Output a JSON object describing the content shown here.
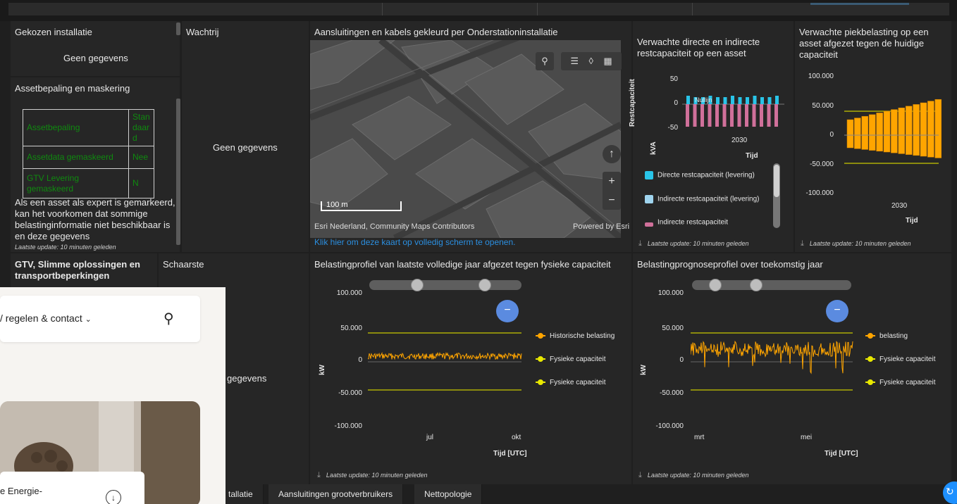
{
  "panels": {
    "gekozen": {
      "title": "Gekozen installatie",
      "nodata": "Geen gegevens"
    },
    "wachtrij": {
      "title": "Wachtrij",
      "nodata": "Geen gegevens"
    },
    "asset": {
      "title": "Assetbepaling en maskering",
      "rows": [
        {
          "label": "Assetbepaling",
          "value": "Standaard"
        },
        {
          "label": "Assetdata gemaskeerd",
          "value": "Nee"
        },
        {
          "label": "GTV Levering gemaskeerd",
          "value": "N"
        }
      ],
      "note": "Als een asset als expert is gemarkeerd, kan het voorkomen dat sommige belastinginformatie niet beschikbaar is en deze gegevens",
      "updated": "Laatste update: 10 minuten geleden"
    },
    "gtv": {
      "title": "GTV, Slimme oplossingen en transportbeperkingen"
    },
    "schaarste": {
      "title": "Schaarste",
      "nodata": "gegevens"
    },
    "map": {
      "title": "Aansluitingen en kabels gekleurd per Onderstationinstallatie",
      "scale": "100 m",
      "attribution": "Esri Nederland, Community Maps Contributors",
      "powered": "Powered by Esri",
      "link": "Klik hier om deze kaart op volledig scherm te openen."
    },
    "restcap": {
      "title": "Verwachte directe en indirecte restcapaciteit op een asset",
      "yticks": [
        "50",
        "0",
        "-50"
      ],
      "xtick": "2030",
      "xtitle": "Tijd",
      "ytitle1": "Restcapaciteit",
      "ytitle2": "kVA",
      "annotation": "Nullijn",
      "legend": [
        "Directe restcapaciteit (levering)",
        "Indirecte restcapaciteit (levering)",
        "Indirecte restcapaciteit"
      ],
      "updated": "Laatste update: 10 minuten geleden"
    },
    "piek": {
      "title": "Verwachte piekbelasting op een asset afgezet tegen de huidige capaciteit",
      "yticks": [
        "100.000",
        "50.000",
        "0",
        "-50.000",
        "-100.000"
      ],
      "xtick": "2030",
      "xtitle": "Tijd",
      "updated": "Laatste update: 10 minuten geleden"
    },
    "profiel": {
      "title": "Belastingprofiel van laatste volledige jaar afgezet tegen fysieke capaciteit",
      "yticks": [
        "100.000",
        "50.000",
        "0",
        "-50.000",
        "-100.000"
      ],
      "xticks": [
        "jul",
        "okt"
      ],
      "xtitle": "Tijd [UTC]",
      "ytitle": "kW",
      "legend": [
        "Historische belasting",
        "Fysieke capaciteit",
        "Fysieke capaciteit"
      ],
      "updated": "Laatste update: 10 minuten geleden"
    },
    "prognose": {
      "title": "Belastingprognoseprofiel over toekomstig jaar",
      "yticks": [
        "100.000",
        "50.000",
        "0",
        "-50.000",
        "-100.000"
      ],
      "xticks": [
        "mrt",
        "mei"
      ],
      "xtitle": "Tijd [UTC]",
      "ytitle": "kW",
      "legend": [
        "belasting",
        "Fysieke capaciteit",
        "Fysieke capaciteit"
      ],
      "updated": "Laatste update: 10 minuten geleden"
    }
  },
  "tabs": [
    "tallatie",
    "Aansluitingen grootverbruikers",
    "Nettopologie"
  ],
  "overlay": {
    "menu": "/ regelen & contact",
    "card_text": "e Energie-"
  },
  "colors": {
    "orange": "#ffa500",
    "yellowline": "#c8c800",
    "cyan": "#29c4e8",
    "lightblue": "#9fd4ee",
    "pink": "#d0709a",
    "link": "#2b8fe0"
  }
}
